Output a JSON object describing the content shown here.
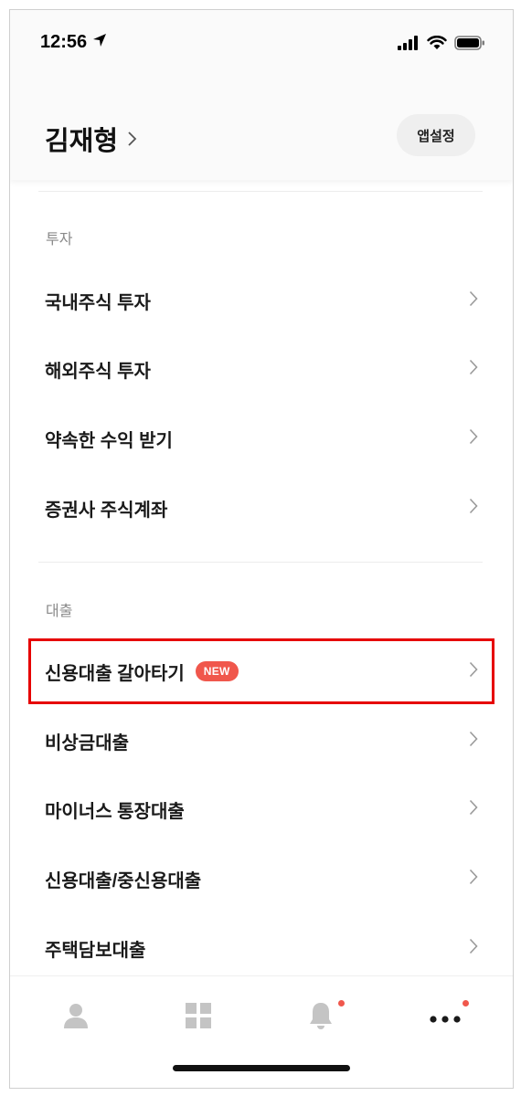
{
  "status_bar": {
    "time": "12:56",
    "icons": [
      "location-arrow-icon",
      "signal-icon",
      "wifi-icon",
      "battery-icon"
    ]
  },
  "header": {
    "user_name": "김재형",
    "app_settings_label": "앱설정"
  },
  "sections": [
    {
      "label": "투자",
      "items": [
        {
          "label": "국내주식 투자"
        },
        {
          "label": "해외주식 투자"
        },
        {
          "label": "약속한 수익 받기"
        },
        {
          "label": "증권사 주식계좌"
        }
      ]
    },
    {
      "label": "대출",
      "items": [
        {
          "label": "신용대출 갈아타기",
          "badge": "NEW"
        },
        {
          "label": "비상금대출"
        },
        {
          "label": "마이너스 통장대출"
        },
        {
          "label": "신용대출/중신용대출"
        },
        {
          "label": "주택담보대출"
        }
      ]
    }
  ],
  "bottom_nav": {
    "items": [
      "person-icon",
      "grid-icon",
      "bell-icon",
      "more-dots-icon"
    ],
    "notification_dot_color": "#f0574c"
  },
  "colors": {
    "accent": "#f0574c",
    "highlight": "#e60000"
  }
}
